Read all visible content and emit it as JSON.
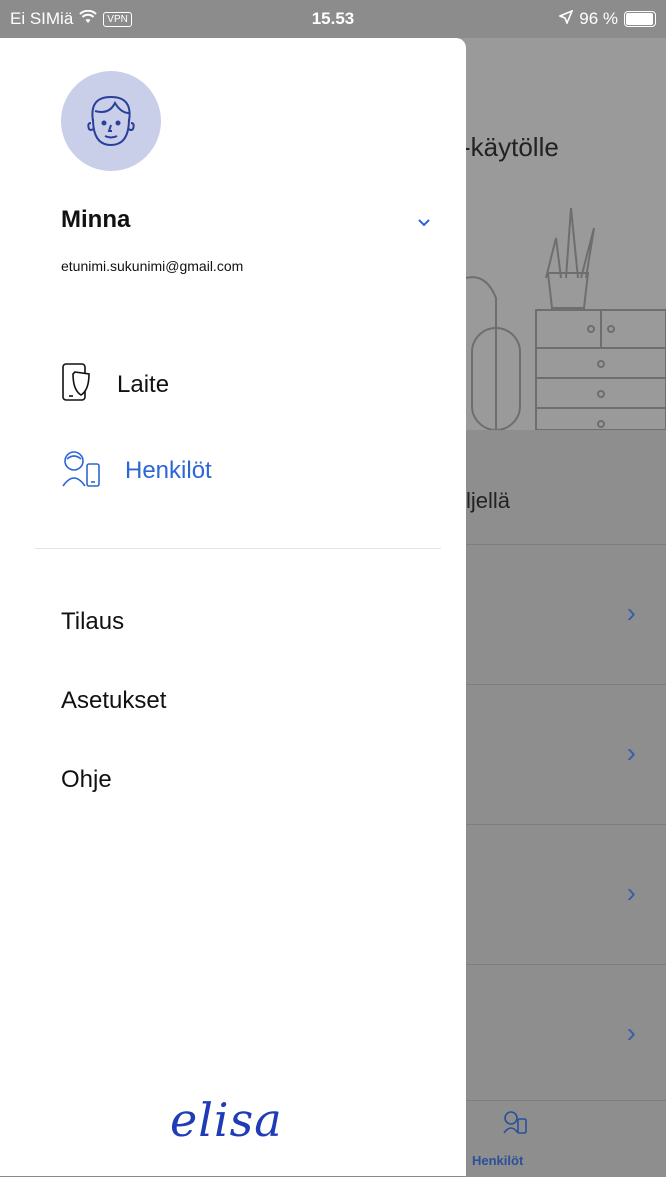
{
  "status_bar": {
    "carrier": "Ei SIMiä",
    "vpn": "VPN",
    "time": "15.53",
    "battery": "96 %",
    "icons": [
      "wifi-icon",
      "location-arrow-icon",
      "battery-icon"
    ]
  },
  "background": {
    "title": "-käytölle",
    "row_text": "ljellä",
    "tab_label": "Henkilöt"
  },
  "drawer": {
    "user_name": "Minna",
    "email": "etunimi.sukunimi@gmail.com",
    "nav": [
      {
        "label": "Laite",
        "icon": "phone-shield-icon"
      },
      {
        "label": "Henkilöt",
        "icon": "people-icon",
        "active": true
      }
    ],
    "menu": [
      {
        "label": "Tilaus"
      },
      {
        "label": "Asetukset"
      },
      {
        "label": "Ohje"
      }
    ],
    "logo": "elisa"
  },
  "colors": {
    "accent": "#2e66d6",
    "logo": "#1f3bb5",
    "avatar_bg": "#c9cfe8"
  }
}
